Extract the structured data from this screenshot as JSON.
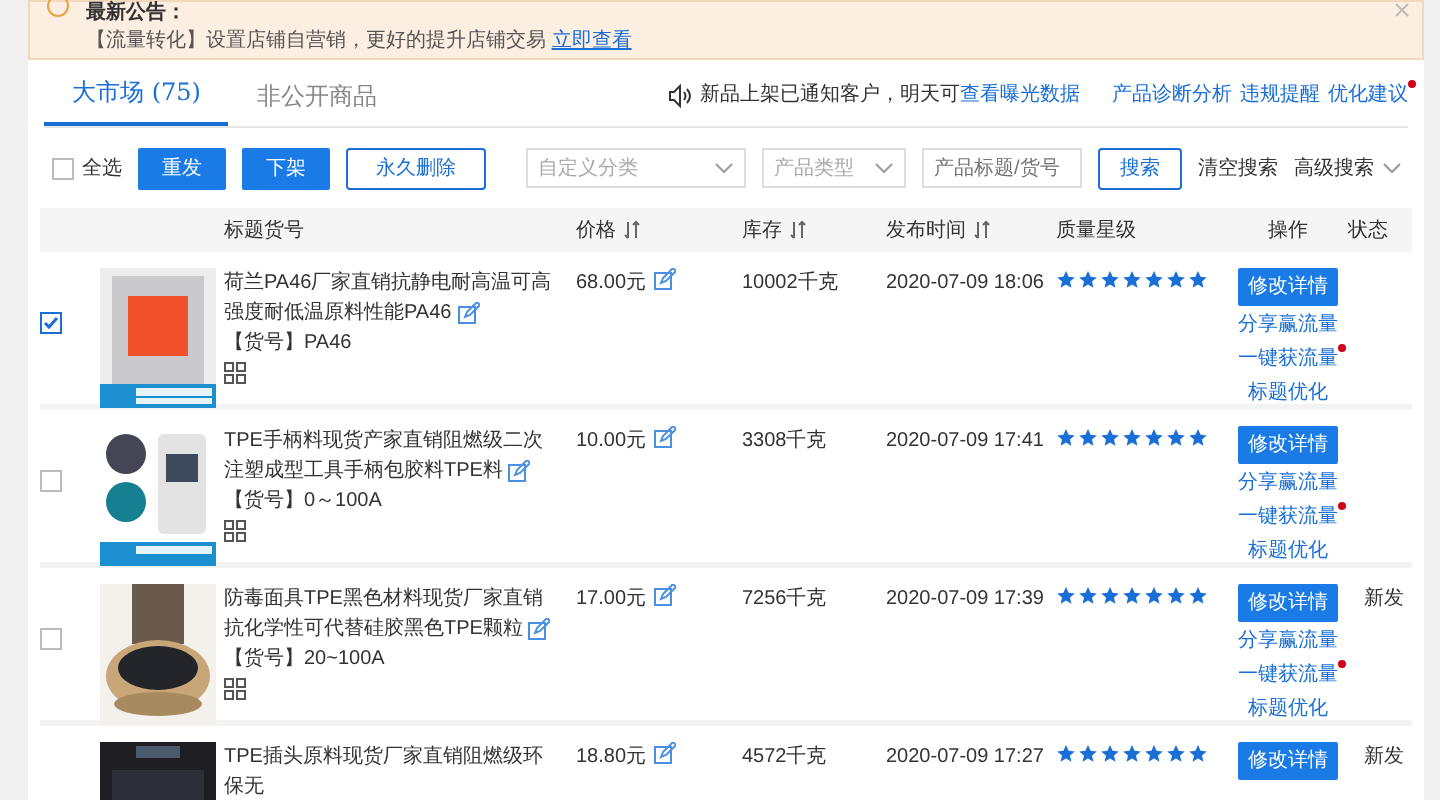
{
  "announcement": {
    "title": "最新公告：",
    "text": "【流量转化】设置店铺自营销，更好的提升店铺交易",
    "link": "立即查看"
  },
  "tabs": [
    {
      "label": "大市场 (75)",
      "selected": true
    },
    {
      "label": "非公开商品",
      "selected": false
    }
  ],
  "notice": {
    "text": "新品上架已通知客户，明天可",
    "link": "查看曝光数据"
  },
  "links": [
    {
      "label": "产品诊断分析",
      "dot": false
    },
    {
      "label": "违规提醒",
      "dot": false
    },
    {
      "label": "优化建议",
      "dot": true
    }
  ],
  "toolbar": {
    "select_all": {
      "label": "全选",
      "checked": false
    },
    "buttons": [
      {
        "label": "重发",
        "kind": "primary"
      },
      {
        "label": "下架",
        "kind": "primary"
      },
      {
        "label": "永久删除",
        "kind": "outline"
      }
    ],
    "filters": [
      {
        "placeholder": "自定义分类",
        "kind": "select"
      },
      {
        "placeholder": "产品类型",
        "kind": "select"
      },
      {
        "placeholder": "产品标题/货号",
        "kind": "input"
      }
    ],
    "search": "搜索",
    "clear": "清空搜索",
    "advanced": "高级搜索"
  },
  "table": {
    "columns": [
      {
        "label": "标题货号",
        "sortable": false
      },
      {
        "label": "价格",
        "sortable": true
      },
      {
        "label": "库存",
        "sortable": true
      },
      {
        "label": "发布时间",
        "sortable": true
      },
      {
        "label": "质量星级",
        "sortable": false
      },
      {
        "label": "操作",
        "sortable": false
      },
      {
        "label": "状态",
        "sortable": false
      }
    ],
    "rows": [
      {
        "checked": true,
        "title": "荷兰PA46厂家直销抗静电耐高温可高强度耐低温原料性能PA46",
        "sku": "【货号】PA46",
        "price": "68.00元",
        "stock": "10002千克",
        "time": "2020-07-09 18:06",
        "stars": 7,
        "actions": [
          {
            "label": "修改详情",
            "kind": "button"
          },
          {
            "label": "分享赢流量",
            "kind": "link",
            "dot": false
          },
          {
            "label": "一键获流量",
            "kind": "link",
            "dot": true
          },
          {
            "label": "标题优化",
            "kind": "link",
            "dot": false
          }
        ]
      },
      {
        "checked": false,
        "title": "TPE手柄料现货产家直销阻燃级二次注塑成型工具手柄包胶料TPE料",
        "sku": "【货号】0～100A",
        "price": "10.00元",
        "stock": "3308千克",
        "time": "2020-07-09 17:41",
        "stars": 7,
        "actions": [
          {
            "label": "修改详情",
            "kind": "button"
          },
          {
            "label": "分享赢流量",
            "kind": "link",
            "dot": false
          },
          {
            "label": "一键获流量",
            "kind": "link",
            "dot": true
          },
          {
            "label": "标题优化",
            "kind": "link",
            "dot": false
          }
        ]
      },
      {
        "checked": false,
        "title": "防毒面具TPE黑色材料现货厂家直销抗化学性可代替硅胶黑色TPE颗粒",
        "sku": "【货号】20~100A",
        "price": "17.00元",
        "stock": "7256千克",
        "time": "2020-07-09 17:39",
        "stars": 7,
        "status": "新发",
        "actions": [
          {
            "label": "修改详情",
            "kind": "button"
          },
          {
            "label": "分享赢流量",
            "kind": "link",
            "dot": false
          },
          {
            "label": "一键获流量",
            "kind": "link",
            "dot": true
          },
          {
            "label": "标题优化",
            "kind": "link",
            "dot": false
          }
        ]
      },
      {
        "title": "TPE插头原料现货厂家直销阻燃级环保无",
        "price": "18.80元",
        "stock": "4572千克",
        "time": "2020-07-09 17:27",
        "stars": 7,
        "status": "新发",
        "actions": [
          {
            "label": "修改详情",
            "kind": "button"
          }
        ]
      }
    ]
  }
}
